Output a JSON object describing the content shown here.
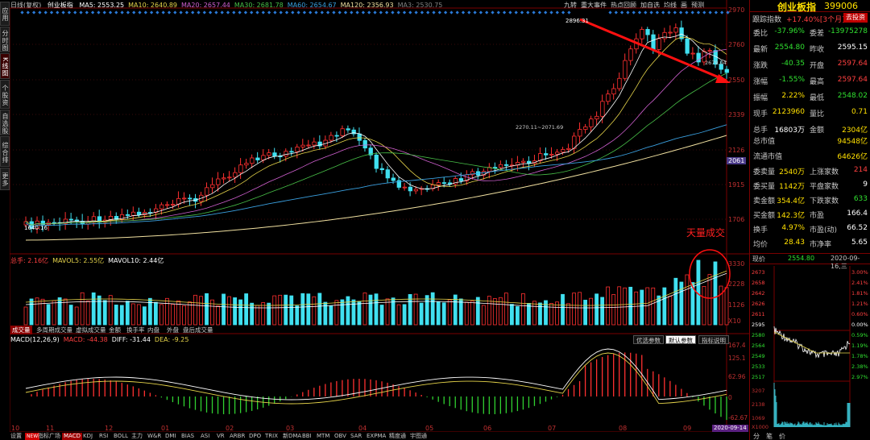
{
  "left_tabs": [
    "应用",
    "分时图",
    "K线图",
    "个股资料",
    "自选股",
    "综合排名",
    "更多"
  ],
  "top": {
    "period": "日线(复权)",
    "title": "创业板指",
    "ma": [
      {
        "label": "MA5: 2553.25",
        "color": "#ffffff"
      },
      {
        "label": "MA10: 2640.89",
        "color": "#e6d44a"
      },
      {
        "label": "MA20: 2657.44",
        "color": "#d060d0"
      },
      {
        "label": "MA30: 2681.78",
        "color": "#48c048"
      },
      {
        "label": "MA60: 2654.67",
        "color": "#3aa0e0"
      },
      {
        "label": "MA120: 2356.93",
        "color": "#f0e0a0"
      },
      {
        "label": "MA3: 2530.75",
        "color": "#808080"
      }
    ],
    "toolbar": [
      "九转",
      "重大事件",
      "热点回顾",
      "加自选",
      "均线",
      "画",
      "预测"
    ]
  },
  "price_axis": [
    "2970",
    "2760",
    "2550",
    "2339",
    "2126",
    "2061",
    "1915",
    "1706"
  ],
  "annotations": {
    "high": "2896.31",
    "low": "1640.16",
    "mid": "2270.11~2071.69",
    "right": "2679.04",
    "big_volume": "天量成交"
  },
  "volume": {
    "header": [
      "总手: 2.16亿",
      "MAVOL5: 2.55亿",
      "MAVOL10: 2.44亿"
    ],
    "axis": [
      "3330",
      "2228",
      "1126",
      "X10"
    ],
    "tabs": [
      "成交量",
      "多周期成交量",
      "虚拟成交量",
      "金额",
      "换手率",
      "内盘",
      "外盘",
      "盘后成交量"
    ]
  },
  "macd": {
    "header": [
      "MACD(12,26,9)",
      "MACD: -44.38",
      "DIFF: -31.44",
      "DEA: -9.25"
    ],
    "buttons": [
      "优选参数",
      "默认参数",
      "指标说明"
    ],
    "axis": [
      "167.4",
      "125.1",
      "62.96",
      "0",
      "-62.67"
    ]
  },
  "x_axis": [
    "10",
    "11",
    "12",
    "01",
    "02",
    "03",
    "04",
    "05",
    "06",
    "07",
    "08",
    "09"
  ],
  "date_badge": "2020-09-14",
  "bottom_tabs": [
    "设置",
    "NEW",
    "指标广场",
    "MACD",
    "KDJ",
    "RSI",
    "BOLL",
    "主力",
    "W&R",
    "DMI",
    "BIAS",
    "ASI",
    "VR",
    "ARBR",
    "DPO",
    "TRIX",
    "新DMA",
    "BBI",
    "MTM",
    "OBV",
    "SAR",
    "EXPMA",
    "精度通",
    "宇图通"
  ],
  "quote": {
    "name": "创业板指",
    "code": "399006",
    "track_label": "跟踪指数",
    "track_value": "+17.40%[3个月]",
    "track_button": "去投资",
    "rows": [
      {
        "k": "委比",
        "v": "-37.96%",
        "k2": "委差",
        "v2": "-13975278",
        "c1": "#30e030",
        "c2": "#30e030"
      },
      {
        "k": "最新",
        "v": "2554.80",
        "k2": "昨收",
        "v2": "2595.15",
        "c1": "#30e030",
        "c2": "#ffffff"
      },
      {
        "k": "涨跌",
        "v": "-40.35",
        "k2": "开盘",
        "v2": "2597.64",
        "c1": "#30e030",
        "c2": "#ff4040"
      },
      {
        "k": "涨幅",
        "v": "-1.55%",
        "k2": "最高",
        "v2": "2597.64",
        "c1": "#30e030",
        "c2": "#ff4040"
      },
      {
        "k": "振幅",
        "v": "2.22%",
        "k2": "最低",
        "v2": "2548.02",
        "c1": "#ffe000",
        "c2": "#30e030"
      },
      {
        "k": "现手",
        "v": "2123960",
        "k2": "量比",
        "v2": "0.71",
        "c1": "#ffe000",
        "c2": "#ffe000"
      },
      {
        "k": "总手",
        "v": "16803万",
        "k2": "金额",
        "v2": "2304亿",
        "c1": "#ffffff",
        "c2": "#ffe000"
      }
    ],
    "cap_rows": [
      {
        "k": "总市值",
        "v": "94548亿"
      },
      {
        "k": "流通市值",
        "v": "64626亿"
      }
    ],
    "rows2": [
      {
        "k": "委卖量",
        "v": "2540万",
        "k2": "上涨家数",
        "v2": "214",
        "c1": "#ffe000",
        "c2": "#ff4040"
      },
      {
        "k": "委买量",
        "v": "1142万",
        "k2": "平盘家数",
        "v2": "9",
        "c1": "#ffe000",
        "c2": "#ffffff"
      },
      {
        "k": "卖金额",
        "v": "354.4亿",
        "k2": "下跌家数",
        "v2": "633",
        "c1": "#ffe000",
        "c2": "#30e030"
      },
      {
        "k": "买金额",
        "v": "142.3亿",
        "k2": "市盈",
        "v2": "166.4",
        "c1": "#ffe000",
        "c2": "#ffffff"
      },
      {
        "k": "换手",
        "v": "4.97%",
        "k2": "市盈(动)",
        "v2": "66.52",
        "c1": "#ffe000",
        "c2": "#ffffff"
      },
      {
        "k": "均价",
        "v": "28.43",
        "k2": "市净率",
        "v2": "5.65",
        "c1": "#ffe000",
        "c2": "#ffffff"
      }
    ],
    "now_label": "现价",
    "now_value": "2554.80",
    "now_date": "2020-09-16,三",
    "mini_left": [
      "2673",
      "2658",
      "2642",
      "2626",
      "2611",
      "2595",
      "2580",
      "2564",
      "2549",
      "2533",
      "2517",
      "3207",
      "2138",
      "1069",
      "X1000"
    ],
    "mini_right": [
      "3.00%",
      "2.41%",
      "1.81%",
      "1.21%",
      "0.60%",
      "0.00%",
      "0.59%",
      "1.19%",
      "1.78%",
      "2.38%",
      "2.97%"
    ],
    "mini_tabs": [
      "分",
      "笔",
      "价"
    ]
  }
}
